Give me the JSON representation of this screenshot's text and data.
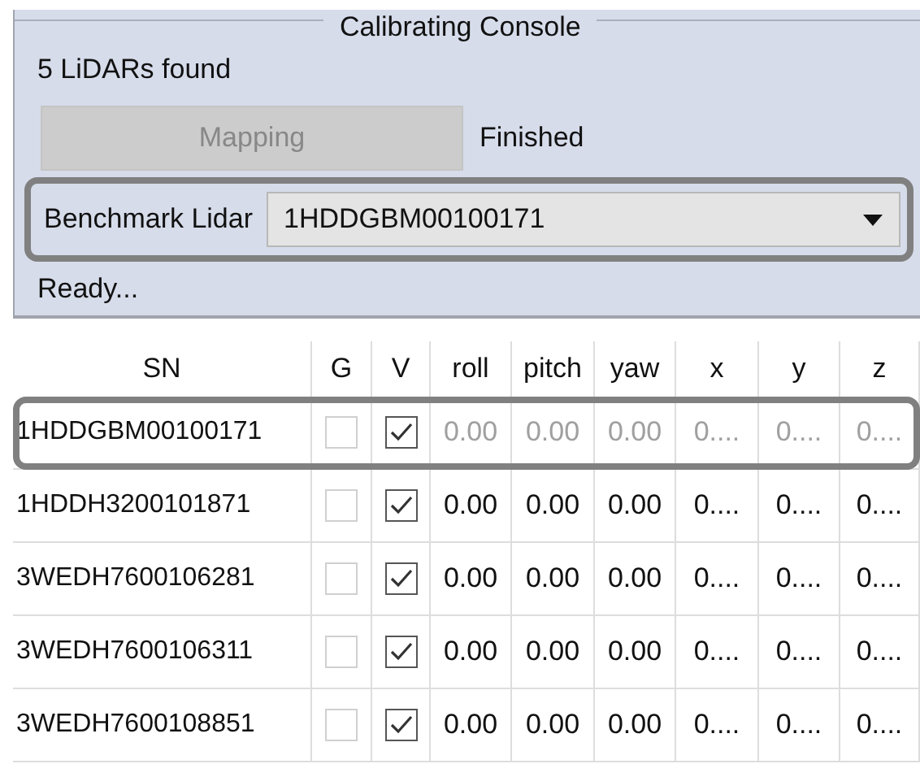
{
  "group": {
    "title": "Calibrating Console",
    "status": "5 LiDARs found",
    "button": {
      "label": "Mapping",
      "disabled": true
    },
    "button_status": "Finished",
    "benchmark": {
      "label": "Benchmark Lidar",
      "value": "1HDDGBM00100171",
      "highlighted": true
    },
    "message": "Ready..."
  },
  "table": {
    "columns": [
      "SN",
      "G",
      "V",
      "roll",
      "pitch",
      "yaw",
      "x",
      "y",
      "z"
    ],
    "rows": [
      {
        "sn": "1HDDGBM00100171",
        "g": false,
        "v": true,
        "values": [
          "0.00",
          "0.00",
          "0.00",
          "0....",
          "0....",
          "0...."
        ],
        "disabled": true,
        "highlighted": true
      },
      {
        "sn": "1HDDH3200101871",
        "g": false,
        "v": true,
        "values": [
          "0.00",
          "0.00",
          "0.00",
          "0....",
          "0....",
          "0...."
        ],
        "disabled": false,
        "highlighted": false
      },
      {
        "sn": "3WEDH7600106281",
        "g": false,
        "v": true,
        "values": [
          "0.00",
          "0.00",
          "0.00",
          "0....",
          "0....",
          "0...."
        ],
        "disabled": false,
        "highlighted": false
      },
      {
        "sn": "3WEDH7600106311",
        "g": false,
        "v": true,
        "values": [
          "0.00",
          "0.00",
          "0.00",
          "0....",
          "0....",
          "0...."
        ],
        "disabled": false,
        "highlighted": false
      },
      {
        "sn": "3WEDH7600108851",
        "g": false,
        "v": true,
        "values": [
          "0.00",
          "0.00",
          "0.00",
          "0....",
          "0....",
          "0...."
        ],
        "disabled": false,
        "highlighted": false
      }
    ]
  }
}
